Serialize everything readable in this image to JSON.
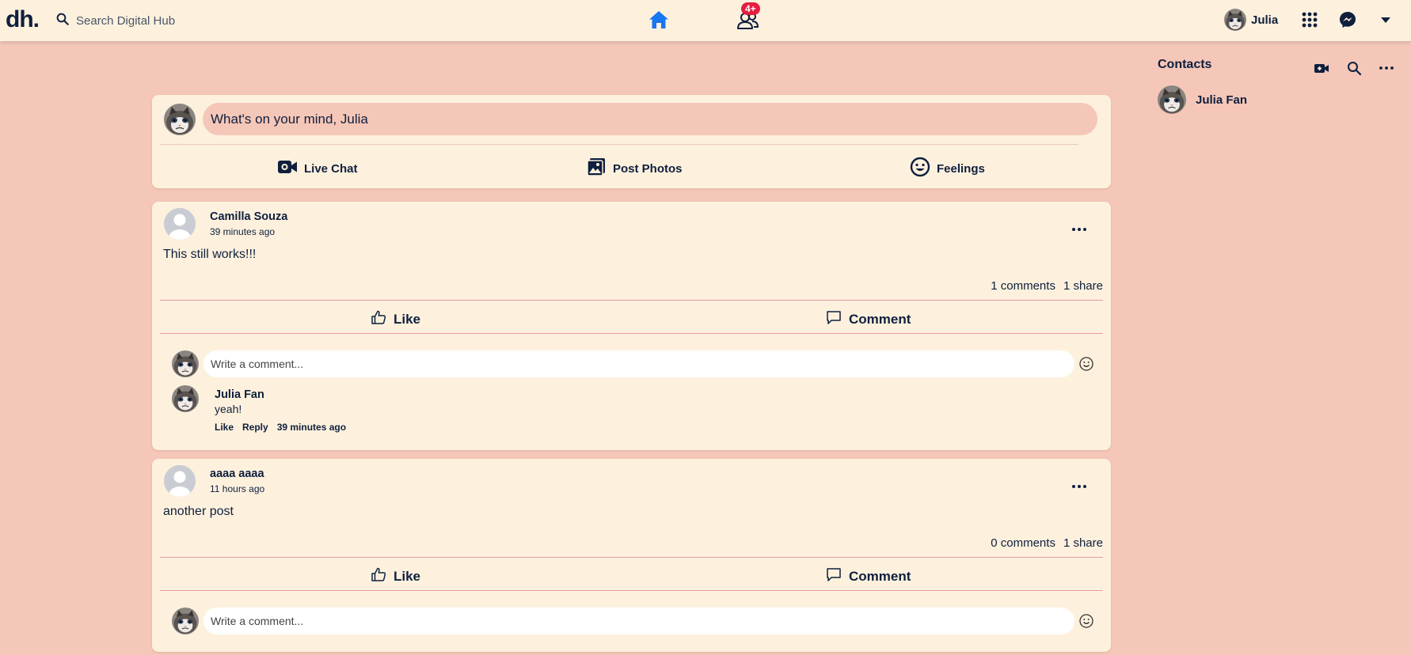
{
  "topbar": {
    "logo": "dh.",
    "search_placeholder": "Search Digital Hub",
    "friends_badge": "4+",
    "profile_name": "Julia",
    "icons": [
      "search-icon",
      "home-icon",
      "friends-icon",
      "apps-grid-icon",
      "messenger-icon",
      "dropdown-caret-icon"
    ]
  },
  "composer": {
    "placeholder": "What's on your mind, Julia",
    "actions": [
      {
        "label": "Live Chat",
        "icon": "video-icon"
      },
      {
        "label": "Post Photos",
        "icon": "photos-icon"
      },
      {
        "label": "Feelings",
        "icon": "smiley-icon"
      }
    ]
  },
  "posts": [
    {
      "author": "Camilla Souza",
      "time": "39 minutes ago",
      "body": "This still works!!!",
      "comments_count": "1 comments",
      "shares_count": "1 share",
      "like_label": "Like",
      "comment_label": "Comment",
      "comment_placeholder": "Write a comment...",
      "comments": [
        {
          "author": "Julia Fan",
          "text": "yeah!",
          "like_label": "Like",
          "reply_label": "Reply",
          "time": "39 minutes ago"
        }
      ]
    },
    {
      "author": "aaaa aaaa",
      "time": "11 hours ago",
      "body": "another post",
      "comments_count": "0 comments",
      "shares_count": "1 share",
      "like_label": "Like",
      "comment_label": "Comment",
      "comment_placeholder": "Write a comment..."
    }
  ],
  "sidebar": {
    "title": "Contacts",
    "contacts": [
      {
        "name": "Julia Fan"
      }
    ]
  },
  "colors": {
    "page_bg": "#f5c7b8",
    "card_bg": "#fdf1de",
    "text": "#0f1f3d",
    "accent_blue": "#1877f2",
    "badge_red": "#e41e3f",
    "divider_pink": "#e89aa3"
  }
}
